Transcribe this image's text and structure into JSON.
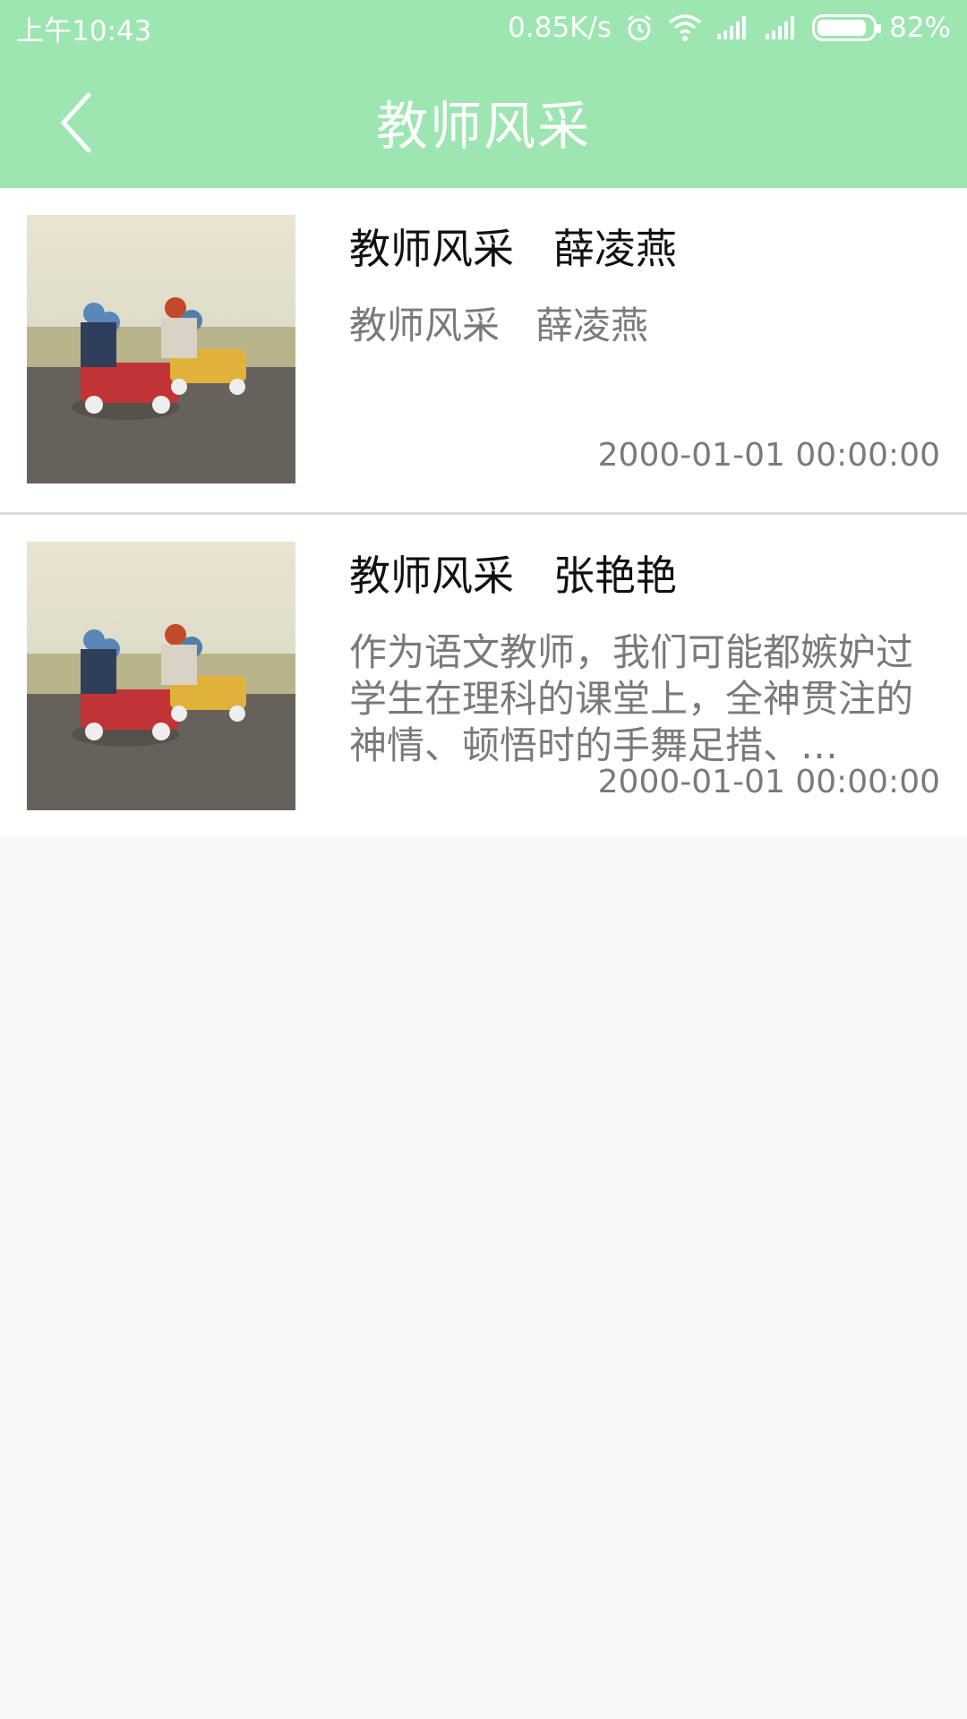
{
  "status_bar": {
    "time": "上午10:43",
    "net_speed": "0.85K/s",
    "battery_percent": "82%",
    "battery_level": 0.82,
    "icons": [
      "alarm-icon",
      "wifi-icon",
      "signal-icon",
      "signal-icon",
      "battery-icon"
    ]
  },
  "header": {
    "title": "教师风采",
    "back_icon": "chevron-left-icon"
  },
  "articles": [
    {
      "title": "教师风采   薛凌燕",
      "summary": "教师风采   薛凌燕",
      "date": "2000-01-01 00:00:00"
    },
    {
      "title": "教师风采   张艳艳",
      "summary": "作为语文教师，我们可能都嫉妒过学生在理科的课堂上，全神贯注的神情、顿悟时的手舞足措、…",
      "date": "2000-01-01 00:00:00"
    }
  ],
  "colors": {
    "accent": "#9de5b1",
    "title_text": "#111111",
    "secondary_text": "#7a7a7a",
    "background": "#f8f8f8"
  }
}
